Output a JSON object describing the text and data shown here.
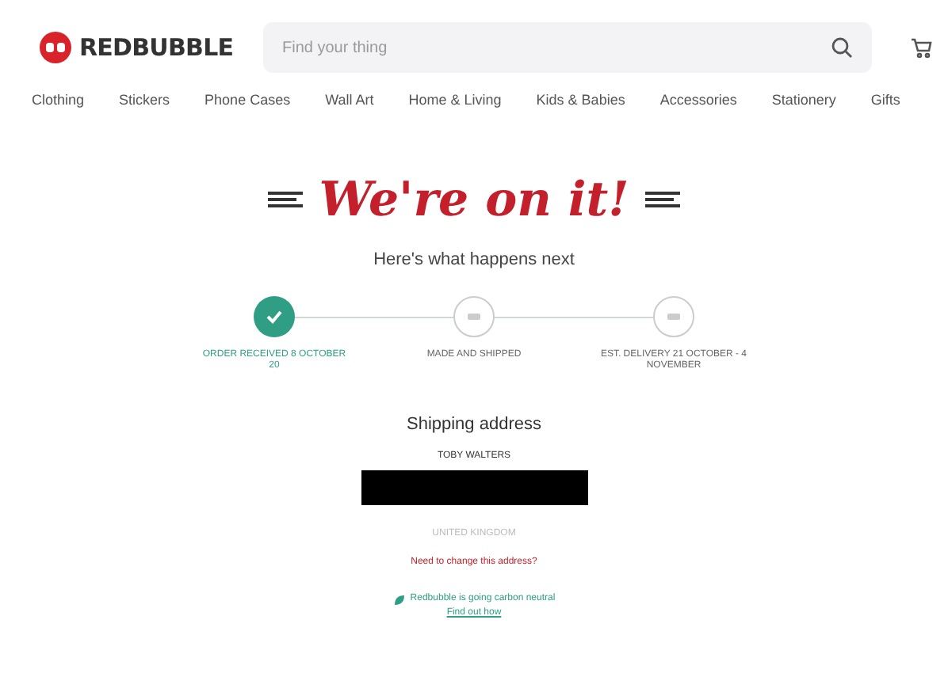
{
  "header": {
    "logo": "REDBUBBLE",
    "search": {
      "placeholder": "Find your thing"
    }
  },
  "nav": [
    "Clothing",
    "Stickers",
    "Phone Cases",
    "Wall Art",
    "Home & Living",
    "Kids & Babies",
    "Accessories",
    "Stationery",
    "Gifts"
  ],
  "title": "We're on it!",
  "subtitle": "Here's what happens next",
  "steps": [
    {
      "label": "ORDER RECEIVED 8 OCTOBER 20",
      "done": true
    },
    {
      "label": "MADE AND SHIPPED",
      "done": false
    },
    {
      "label": "EST. DELIVERY 21 OCTOBER - 4 NOVEMBER",
      "done": false
    }
  ],
  "shipping": {
    "heading": "Shipping address",
    "name": "TOBY WALTERS",
    "country": "UNITED KINGDOM",
    "change_link": "Need to change this address?"
  },
  "carbon": {
    "text": "Redbubble is going carbon neutral",
    "link": "Find out how"
  }
}
